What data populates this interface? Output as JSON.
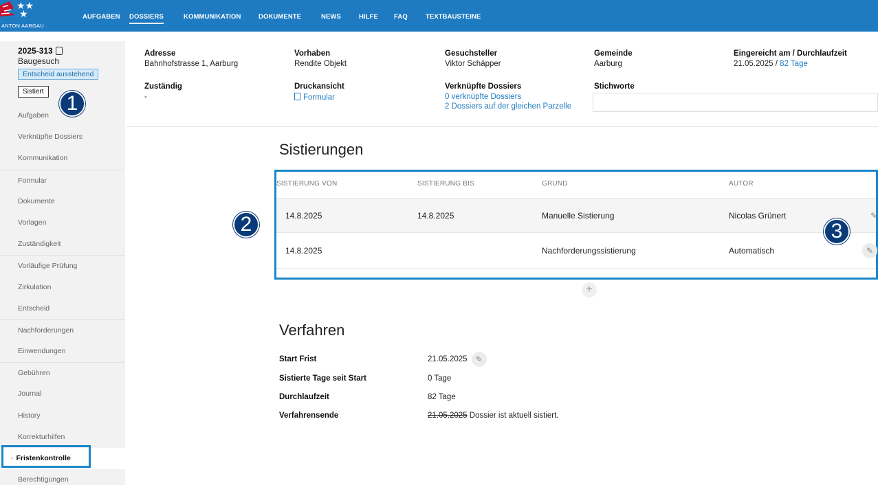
{
  "app": {
    "logo_text": "ANTON AARGAU",
    "nav": [
      "AUFGABEN",
      "DOSSIERS",
      "KOMMUNIKATION",
      "DOKUMENTE",
      "NEWS",
      "HILFE",
      "FAQ",
      "TEXTBAUSTEINE"
    ],
    "active_nav": "DOSSIERS"
  },
  "sidebar": {
    "case_number": "2025-313",
    "case_type": "Baugesuch",
    "status_badge": "Entscheid ausstehend",
    "suspended_badge": "Sistiert",
    "items": [
      "Aufgaben",
      "Verknüpfte Dossiers",
      "Kommunikation",
      "Formular",
      "Dokumente",
      "Vorlagen",
      "Zuständigkeit",
      "Vorläufige Prüfung",
      "Zirkulation",
      "Entscheid",
      "Nachforderungen",
      "Einwendungen",
      "Gebühren",
      "Journal",
      "History",
      "Korrekturhilfen",
      "Fristenkontrolle",
      "Berechtigungen"
    ],
    "active_item": "Fristenkontrolle"
  },
  "header": {
    "adresse_label": "Adresse",
    "adresse": "Bahnhofstrasse 1, Aarburg",
    "vorhaben_label": "Vorhaben",
    "vorhaben": "Rendite Objekt",
    "gesuchsteller_label": "Gesuchsteller",
    "gesuchsteller": "Viktor Schäpper",
    "gemeinde_label": "Gemeinde",
    "gemeinde": "Aarburg",
    "eingereicht_label": "Eingereicht am / Durchlaufzeit",
    "eingereicht_date": "21.05.2025",
    "eingereicht_sep": " / ",
    "durchlaufzeit_link": "82 Tage",
    "zustaendig_label": "Zuständig",
    "zustaendig": "-",
    "druckansicht_label": "Druckansicht",
    "druckansicht_link": "Formular",
    "verknuepfte_label": "Verknüpfte Dossiers",
    "verknuepfte_link1": "0 verknüpfte Dossiers",
    "verknuepfte_link2": "2 Dossiers auf der gleichen Parzelle",
    "stichworte_label": "Stichworte"
  },
  "sistierungen": {
    "title": "Sistierungen",
    "columns": [
      "SISTIERUNG VON",
      "SISTIERUNG BIS",
      "GRUND",
      "AUTOR"
    ],
    "rows": [
      [
        "14.8.2025",
        "14.8.2025",
        "Manuelle Sistierung",
        "Nicolas Grünert"
      ],
      [
        "14.8.2025",
        "",
        "Nachforderungssistierung",
        "Automatisch"
      ]
    ],
    "add_symbol": "+"
  },
  "verfahren": {
    "title": "Verfahren",
    "rows": [
      {
        "label": "Start Frist",
        "value": "21.05.2025"
      },
      {
        "label": "Sistierte Tage seit Start",
        "value": "0 Tage"
      },
      {
        "label": "Durchlaufzeit",
        "value": "82 Tage"
      },
      {
        "label": "Verfahrensende",
        "value": "21.05.2025",
        "note": " Dossier ist aktuell sistiert."
      }
    ]
  },
  "markers": [
    "1",
    "2",
    "3"
  ],
  "colors": {
    "primary": "#1f7bc1",
    "highlight_border": "#1a86c9",
    "marker": "#0a3a78"
  }
}
